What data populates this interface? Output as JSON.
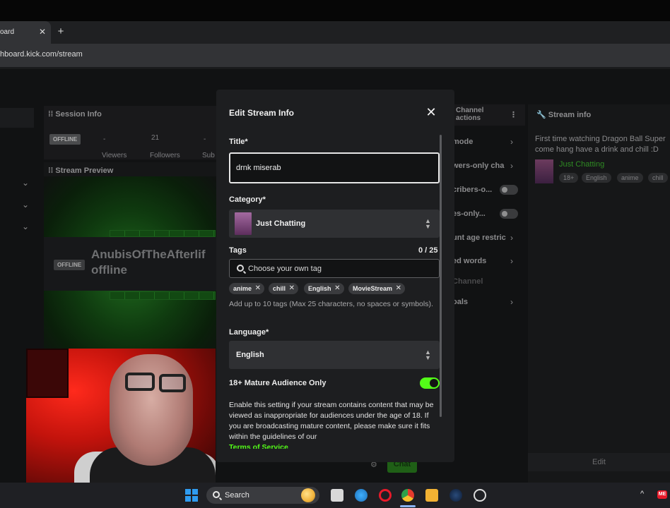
{
  "browser": {
    "tab_title": "oard",
    "tab_close": "✕",
    "new_tab": "+",
    "url": "hboard.kick.com/stream"
  },
  "dashboard": {
    "session_info_title": "Session Info",
    "offline_badge": "OFFLINE",
    "viewers_value": "-",
    "viewers_label": "Viewers",
    "followers_value": "21",
    "followers_label": "Followers",
    "subs_value": "-",
    "subs_label": "Sub",
    "stream_preview_title": "Stream Preview",
    "preview_offline_chip": "OFFLINE",
    "streamer_name": "AnubisOfTheAfterlif",
    "streamer_status": "offline",
    "channel_actions_title": "Channel actions",
    "right_items": [
      {
        "label": "mode"
      },
      {
        "label": "wers-only cha"
      },
      {
        "label": "cribers-o..."
      },
      {
        "label": "es-only..."
      },
      {
        "label": "unt age restric"
      },
      {
        "label": "ed words"
      },
      {
        "label": "Channel"
      },
      {
        "label": "oals"
      }
    ],
    "chat_button": "Chat"
  },
  "stream_info_panel": {
    "title": "Stream info",
    "description": "First time watching Dragon Ball Super come hang have a drink and chill :D",
    "category": "Just Chatting",
    "tags": [
      "18+",
      "English",
      "anime",
      "chill"
    ],
    "edit_button": "Edit"
  },
  "modal": {
    "title": "Edit Stream Info",
    "close_icon": "✕",
    "title_label": "Title*",
    "title_value": "drnk miserab",
    "category_label": "Category*",
    "category_value": "Just Chatting",
    "tags_label": "Tags",
    "tags_count": "0 / 25",
    "tags_placeholder": "Choose your own tag",
    "tags": [
      {
        "label": "anime"
      },
      {
        "label": "chill"
      },
      {
        "label": "English"
      },
      {
        "label": "MovieStream"
      }
    ],
    "tags_help": "Add up to 10 tags (Max 25 characters, no spaces or symbols).",
    "language_label": "Language*",
    "language_value": "English",
    "mature_label": "18+ Mature Audience Only",
    "mature_enabled": true,
    "mature_description": "Enable this setting if your stream contains content that may be viewed as inappropriate for audiences under the age of 18. If you are broadcasting mature content, please make sure it fits within the guidelines of our",
    "terms_link": "Terms of Service",
    "accent_color": "#53fc18"
  },
  "taskbar": {
    "search_label": "Search",
    "tray_chevron": "^",
    "notification_badge": "ME"
  }
}
